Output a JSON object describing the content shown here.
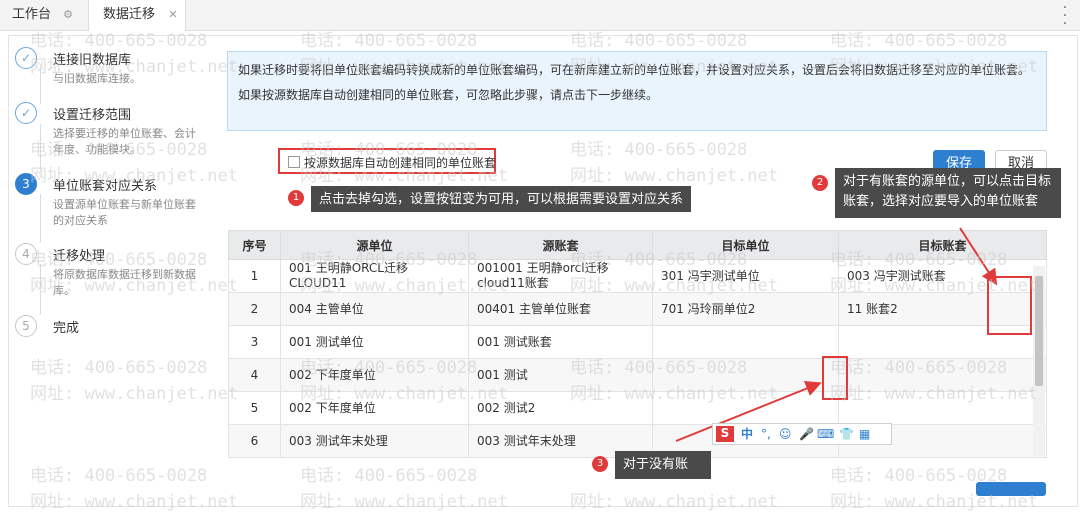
{
  "tabs": [
    {
      "label": "工作台",
      "icon": "gear-icon"
    },
    {
      "label": "数据迁移",
      "icon": "close-icon"
    }
  ],
  "steps": [
    {
      "num": "✓",
      "title": "连接旧数据库",
      "desc": "与旧数据库连接。",
      "state": "done"
    },
    {
      "num": "✓",
      "title": "设置迁移范围",
      "desc": "选择要迁移的单位账套、会计年度、功能模块。",
      "state": "done"
    },
    {
      "num": "3",
      "title": "单位账套对应关系",
      "desc": "设置源单位账套与新单位账套的对应关系",
      "state": "active"
    },
    {
      "num": "4",
      "title": "迁移处理",
      "desc": "将原数据库数据迁移到新数据库。",
      "state": "todo"
    },
    {
      "num": "5",
      "title": "完成",
      "desc": "",
      "state": "todo"
    }
  ],
  "info": {
    "line1": "如果迁移时要将旧单位账套编码转换成新的单位账套编码，可在新库建立新的单位账套，并设置对应关系，设置后会将旧数据迁移至对应的单位账套。",
    "line2": "如果按源数据库自动创建相同的单位账套，可忽略此步骤，请点击下一步继续。"
  },
  "checkbox": {
    "label": "按源数据库自动创建相同的单位账套"
  },
  "buttons": {
    "save": "保存",
    "cancel": "取消"
  },
  "tips": {
    "t1": {
      "num": "1",
      "text": "点击去掉勾选，设置按钮变为可用，可以根据需要设置对应关系"
    },
    "t2": {
      "num": "2",
      "text": "对于有账套的源单位，可以点击目标账套，选择对应要导入的单位账套"
    },
    "t3": {
      "num": "3",
      "text": "对于没有账"
    }
  },
  "table": {
    "headers": [
      "序号",
      "源单位",
      "源账套",
      "目标单位",
      "目标账套"
    ],
    "rows": [
      [
        "1",
        "001 王明静ORCL迁移CLOUD11",
        "001001 王明静orcl迁移cloud11账套",
        "301 冯宇测试单位",
        "003 冯宇测试账套"
      ],
      [
        "2",
        "004 主管单位",
        "00401 主管单位账套",
        "701 冯玲丽单位2",
        "11 账套2"
      ],
      [
        "3",
        "001 测试单位",
        "001 测试账套",
        "",
        ""
      ],
      [
        "4",
        "002 下年度单位",
        "001 测试",
        "",
        ""
      ],
      [
        "5",
        "002 下年度单位",
        "002 测试2",
        "",
        ""
      ],
      [
        "6",
        "003 测试年末处理",
        "003 测试年末处理",
        "",
        ""
      ]
    ]
  },
  "ime": {
    "brand": "S",
    "items": [
      "中",
      "°,",
      "☺",
      "🎤",
      "⌨",
      "👕",
      "▦"
    ]
  },
  "watermark": {
    "phone": "电话: 400-665-0028",
    "site": "网址: www.chanjet.net"
  },
  "colors": {
    "accent": "#2f7fd1",
    "annotation": "#e03a3a",
    "tooltip": "#4a4a4a",
    "info_bg": "#eaf4fd"
  }
}
